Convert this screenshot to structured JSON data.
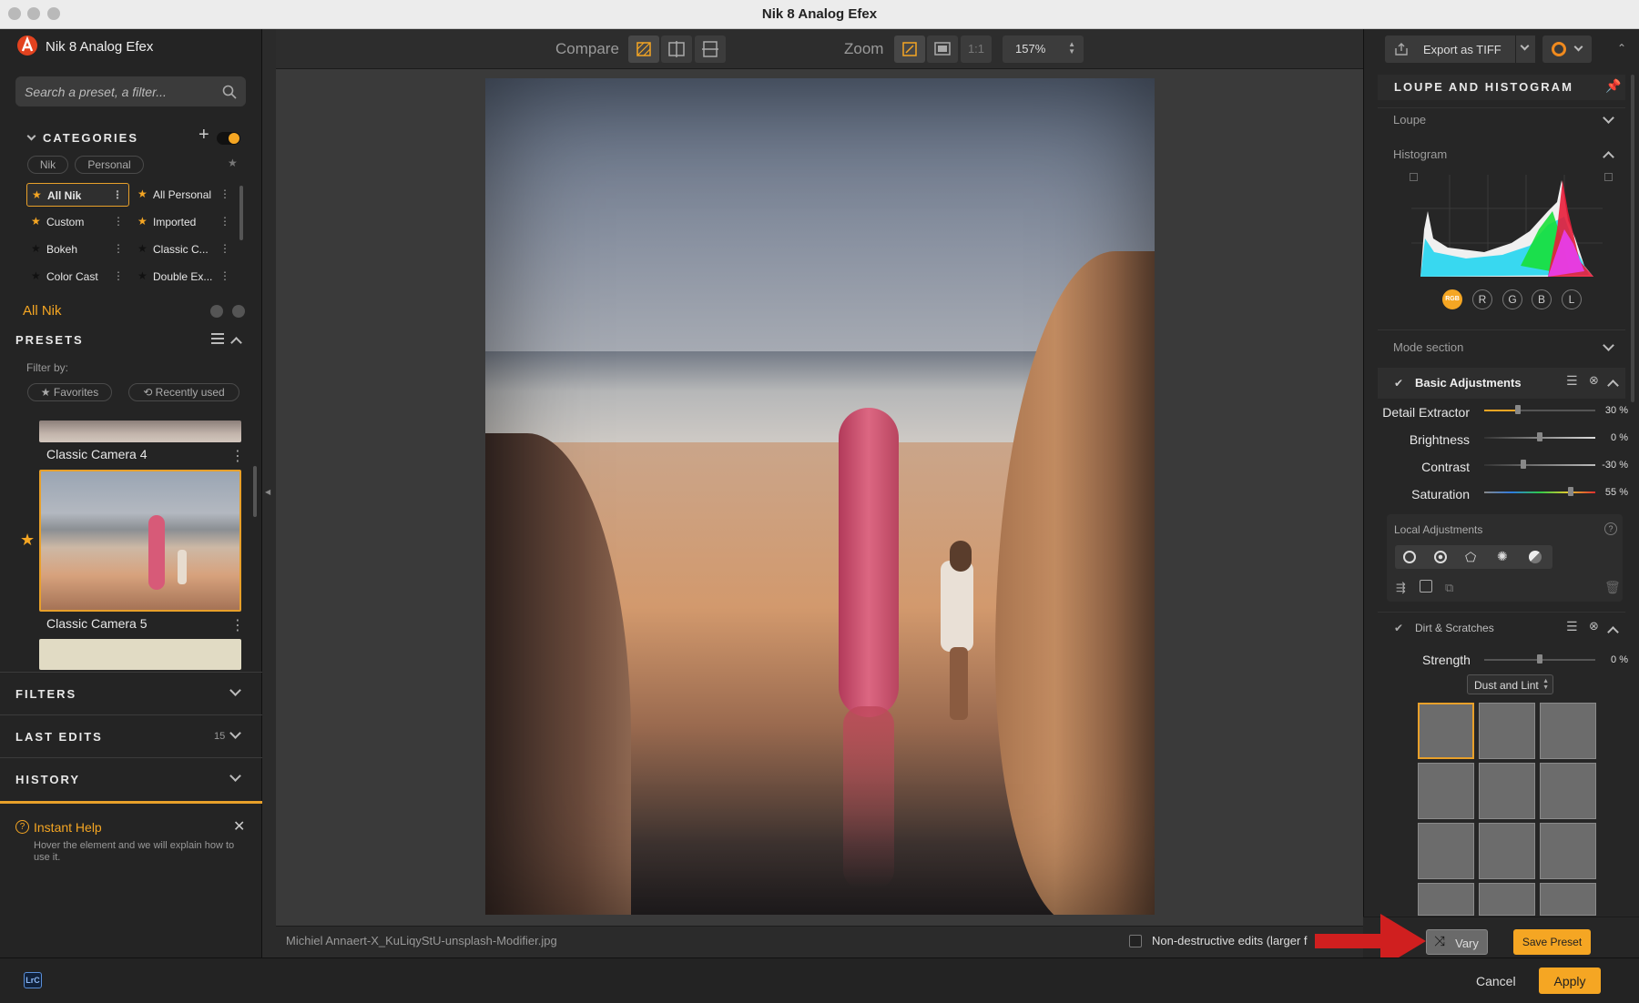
{
  "window": {
    "title": "Nik 8 Analog Efex"
  },
  "app": {
    "name": "Nik 8 Analog Efex"
  },
  "search": {
    "placeholder": "Search a preset, a filter..."
  },
  "categories": {
    "header": "CATEGORIES",
    "tabs": [
      "Nik",
      "Personal"
    ],
    "items": [
      {
        "label": "All Nik",
        "fav": true,
        "selected": true
      },
      {
        "label": "All Personal",
        "fav": true
      },
      {
        "label": "Custom",
        "fav": true
      },
      {
        "label": "Imported",
        "fav": true
      },
      {
        "label": "Bokeh",
        "fav": false
      },
      {
        "label": "Classic C...",
        "fav": false
      },
      {
        "label": "Color Cast",
        "fav": false
      },
      {
        "label": "Double Ex...",
        "fav": false
      }
    ],
    "current": "All Nik"
  },
  "presets": {
    "header": "PRESETS",
    "filter_label": "Filter by:",
    "filters": [
      "Favorites",
      "Recently used"
    ],
    "items": [
      {
        "name": "Classic Camera 4"
      },
      {
        "name": "Classic Camera 5",
        "favorite": true,
        "selected": true
      }
    ]
  },
  "sections": {
    "filters": "FILTERS",
    "last_edits": "LAST EDITS",
    "last_edits_count": "15",
    "history": "HISTORY"
  },
  "instant_help": {
    "title": "Instant Help",
    "text": "Hover the element and we will explain how to use it."
  },
  "toolbar": {
    "compare_label": "Compare",
    "zoom_label": "Zoom",
    "zoom_1to1": "1:1",
    "zoom_value": "157%"
  },
  "export": {
    "label": "Export as TIFF"
  },
  "panel": {
    "loupe_histogram": "LOUPE AND HISTOGRAM",
    "loupe": "Loupe",
    "histogram": "Histogram",
    "channels": [
      "RGB",
      "R",
      "G",
      "B",
      "L"
    ],
    "mode_section": "Mode section"
  },
  "basic_adjustments": {
    "title": "Basic Adjustments",
    "sliders": [
      {
        "label": "Detail Extractor",
        "value": "30 %",
        "level": 0.3
      },
      {
        "label": "Brightness",
        "value": "0 %",
        "level": 0.5
      },
      {
        "label": "Contrast",
        "value": "-30 %",
        "level": 0.35
      },
      {
        "label": "Saturation",
        "value": "55 %",
        "level": 0.78
      }
    ]
  },
  "local_adjustments": {
    "title": "Local Adjustments"
  },
  "dirt_scratches": {
    "title": "Dirt & Scratches",
    "strength_label": "Strength",
    "strength_value": "0 %",
    "strength_level": 0.5,
    "type": "Dust and Lint"
  },
  "image": {
    "filename": "Michiel Annaert-X_KuLiqyStU-unsplash-Modifier.jpg"
  },
  "options": {
    "nondestructive": "Non-destructive edits (larger f"
  },
  "actions": {
    "vary": "Vary",
    "save_preset": "Save Preset",
    "cancel": "Cancel",
    "apply": "Apply"
  },
  "host": {
    "badge": "LrC"
  },
  "colors": {
    "accent": "#f5a623",
    "arrow": "#d01f1f"
  }
}
